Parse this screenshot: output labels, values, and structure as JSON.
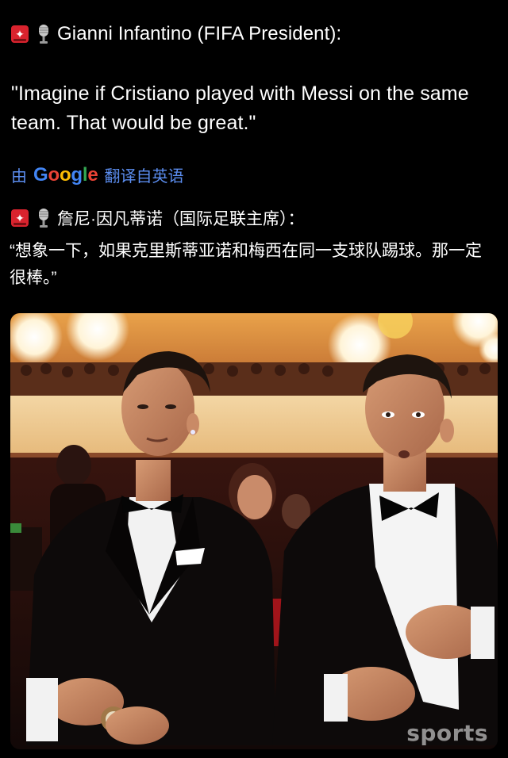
{
  "post": {
    "header": {
      "siren_icon": "police-siren-emoji",
      "mic_icon": "studio-microphone-emoji",
      "text": "Gianni Infantino (FIFA President):"
    },
    "quote": "\"Imagine if Cristiano played with Messi on the same team. That would be great.\"",
    "translation": {
      "prefix": "由",
      "google": [
        "G",
        "o",
        "o",
        "g",
        "l",
        "e"
      ],
      "suffix": "翻译自英语",
      "color": "#5b8def"
    },
    "translated": {
      "header": "詹尼·因凡蒂诺（国际足联主席）：",
      "quote": "“想象一下，如果克里斯蒂亚诺和梅西在同一支球队踢球。那一定很棒。”"
    },
    "photo": {
      "alt_subject": "two players in tuxedos at a gala",
      "watermark": "sports"
    }
  }
}
